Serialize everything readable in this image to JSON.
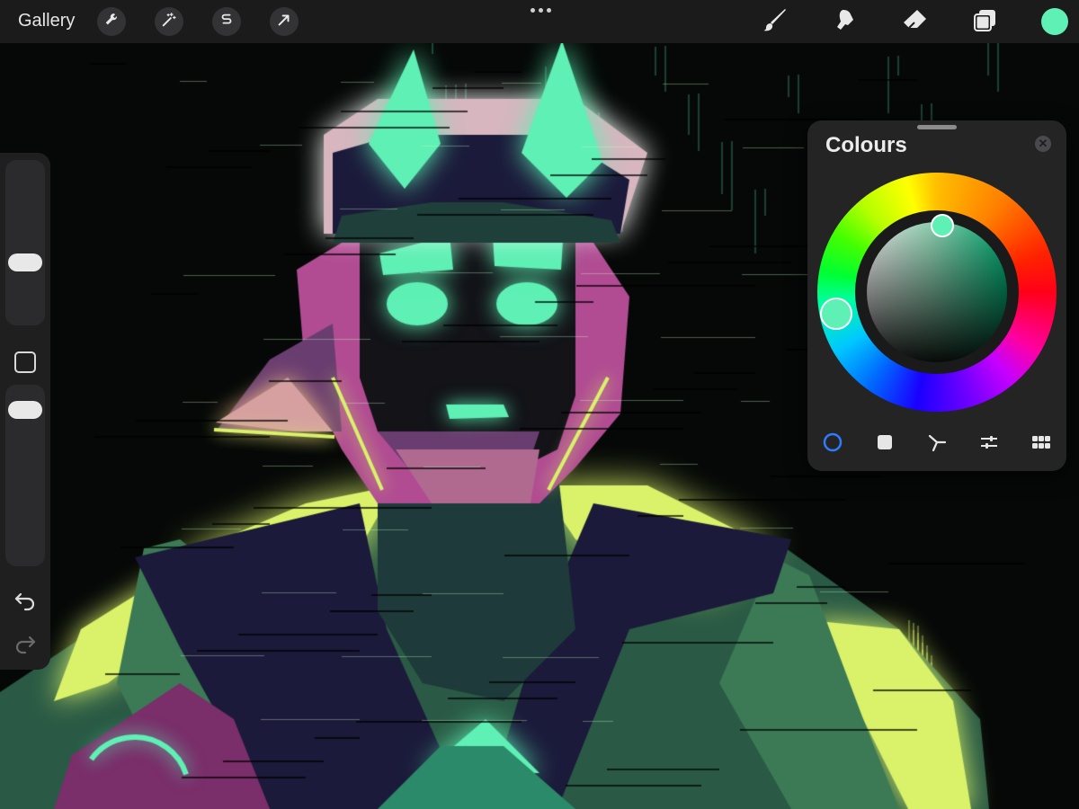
{
  "topbar": {
    "gallery_label": "Gallery",
    "left_tools": [
      {
        "name": "actions",
        "icon": "wrench-icon"
      },
      {
        "name": "adjustments",
        "icon": "magic-wand-icon"
      },
      {
        "name": "selection",
        "icon": "selection-s-icon"
      },
      {
        "name": "transform",
        "icon": "arrow-cursor-icon"
      }
    ],
    "right_tools": [
      {
        "name": "brush",
        "icon": "brush-icon"
      },
      {
        "name": "smudge",
        "icon": "smudge-icon"
      },
      {
        "name": "eraser",
        "icon": "eraser-icon"
      },
      {
        "name": "layers",
        "icon": "layers-icon"
      }
    ],
    "current_colour": "#5ef0b4"
  },
  "sidebar": {
    "size_icon": "brush-size-slider",
    "opacity_icon": "opacity-slider",
    "modify_icon": "modify-square-icon",
    "undo_icon": "undo-icon",
    "redo_icon": "redo-icon"
  },
  "colours_panel": {
    "title": "Colours",
    "close_icon": "close-icon",
    "selected_colour": "#5ef0b4",
    "modes": [
      {
        "name": "disc",
        "icon": "disc-icon",
        "active": true
      },
      {
        "name": "classic",
        "icon": "classic-square-icon",
        "active": false
      },
      {
        "name": "harmony",
        "icon": "harmony-icon",
        "active": false
      },
      {
        "name": "value",
        "icon": "sliders-icon",
        "active": false
      },
      {
        "name": "palettes",
        "icon": "palette-grid-icon",
        "active": false
      }
    ],
    "active_mode_colour": "#2f7bff"
  },
  "artwork": {
    "palette": {
      "background": "#050807",
      "glow_green": "#5ef0b4",
      "lime": "#d9f26a",
      "magenta": "#b14c93",
      "navy": "#1b1a3a",
      "dark_teal": "#1e3a3a"
    }
  }
}
